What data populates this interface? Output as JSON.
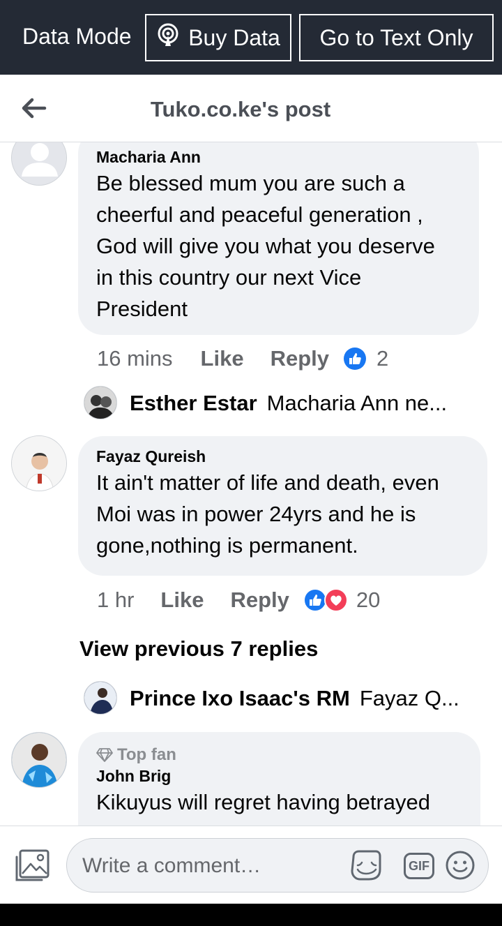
{
  "topbar": {
    "data_mode_label": "Data Mode",
    "buy_data_label": "Buy Data",
    "text_only_label": "Go to Text Only"
  },
  "header": {
    "title": "Tuko.co.ke's post"
  },
  "comments": [
    {
      "author": "Macharia Ann",
      "lines": [
        "Be blessed mum you are such a",
        "cheerful and peaceful generation ,",
        "God will give you what you deserve",
        "in this country our next Vice",
        "President"
      ],
      "time": "16 mins",
      "like_label": "Like",
      "reply_label": "Reply",
      "reaction_count": "2",
      "reactions": [
        "like-icon"
      ],
      "reply_preview": {
        "name": "Esther Estar",
        "text": "Macharia Ann ne..."
      }
    },
    {
      "author": "Fayaz Qureish",
      "lines": [
        "It ain't matter of life and death, even",
        "Moi was in power 24yrs and he is",
        "gone,nothing is permanent."
      ],
      "time": "1 hr",
      "like_label": "Like",
      "reply_label": "Reply",
      "reaction_count": "20",
      "reactions": [
        "like-icon",
        "love-icon"
      ],
      "view_previous": "View previous 7 replies",
      "reply_preview": {
        "name": "Prince Ixo Isaac's RM",
        "text": "Fayaz Q..."
      }
    },
    {
      "badge": "Top fan",
      "author": "John Brig",
      "lines": [
        "Kikuyus will regret having betrayed"
      ]
    }
  ],
  "composer": {
    "placeholder": "Write a comment…",
    "gif_label": "GIF"
  },
  "colors": {
    "topbar_bg": "#242a35",
    "bubble_bg": "#f0f2f5",
    "like_blue": "#1877f2",
    "love_red": "#f33e58",
    "secondary_text": "#65676b"
  }
}
